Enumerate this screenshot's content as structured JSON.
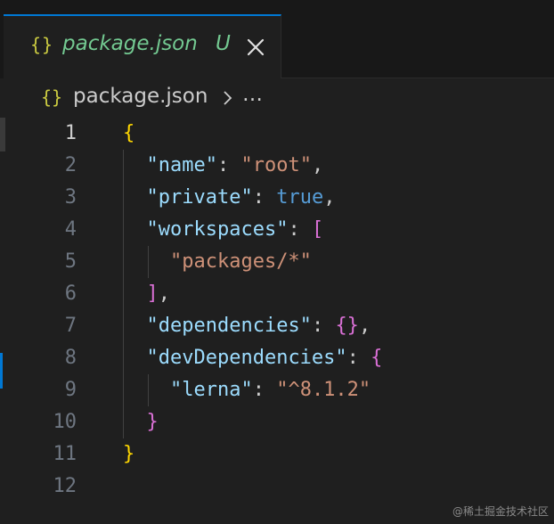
{
  "tab": {
    "icon": "{}",
    "icon_name": "json-braces-icon",
    "label": "package.json",
    "badge": "U",
    "close_icon": "close-icon"
  },
  "breadcrumb": {
    "icon": "{}",
    "file": "package.json",
    "more": "…"
  },
  "editor": {
    "line_numbers": [
      "1",
      "2",
      "3",
      "4",
      "5",
      "6",
      "7",
      "8",
      "9",
      "10",
      "11",
      "12"
    ],
    "active_line": 1,
    "lines": [
      [
        {
          "t": "{",
          "c": "b1"
        }
      ],
      [
        {
          "t": "  ",
          "c": "p"
        },
        {
          "t": "\"name\"",
          "c": "k"
        },
        {
          "t": ": ",
          "c": "p"
        },
        {
          "t": "\"root\"",
          "c": "s"
        },
        {
          "t": ",",
          "c": "p"
        }
      ],
      [
        {
          "t": "  ",
          "c": "p"
        },
        {
          "t": "\"private\"",
          "c": "k"
        },
        {
          "t": ": ",
          "c": "p"
        },
        {
          "t": "true",
          "c": "bool"
        },
        {
          "t": ",",
          "c": "p"
        }
      ],
      [
        {
          "t": "  ",
          "c": "p"
        },
        {
          "t": "\"workspaces\"",
          "c": "k"
        },
        {
          "t": ": ",
          "c": "p"
        },
        {
          "t": "[",
          "c": "b2"
        }
      ],
      [
        {
          "t": "    ",
          "c": "p"
        },
        {
          "t": "\"packages/*\"",
          "c": "s"
        }
      ],
      [
        {
          "t": "  ",
          "c": "p"
        },
        {
          "t": "]",
          "c": "b2"
        },
        {
          "t": ",",
          "c": "p"
        }
      ],
      [
        {
          "t": "  ",
          "c": "p"
        },
        {
          "t": "\"dependencies\"",
          "c": "k"
        },
        {
          "t": ": ",
          "c": "p"
        },
        {
          "t": "{}",
          "c": "b2"
        },
        {
          "t": ",",
          "c": "p"
        }
      ],
      [
        {
          "t": "  ",
          "c": "p"
        },
        {
          "t": "\"devDependencies\"",
          "c": "k"
        },
        {
          "t": ": ",
          "c": "p"
        },
        {
          "t": "{",
          "c": "b2"
        }
      ],
      [
        {
          "t": "    ",
          "c": "p"
        },
        {
          "t": "\"lerna\"",
          "c": "k"
        },
        {
          "t": ": ",
          "c": "p"
        },
        {
          "t": "\"^8.1.2\"",
          "c": "s"
        }
      ],
      [
        {
          "t": "  ",
          "c": "p"
        },
        {
          "t": "}",
          "c": "b2"
        }
      ],
      [
        {
          "t": "}",
          "c": "b1"
        }
      ],
      []
    ]
  },
  "watermark": "@稀土掘金技术社区",
  "colors": {
    "background": "#1f1f1f",
    "tab_accent": "#0078d4",
    "untracked_green": "#73c991",
    "json_icon_yellow": "#cbcb41"
  }
}
